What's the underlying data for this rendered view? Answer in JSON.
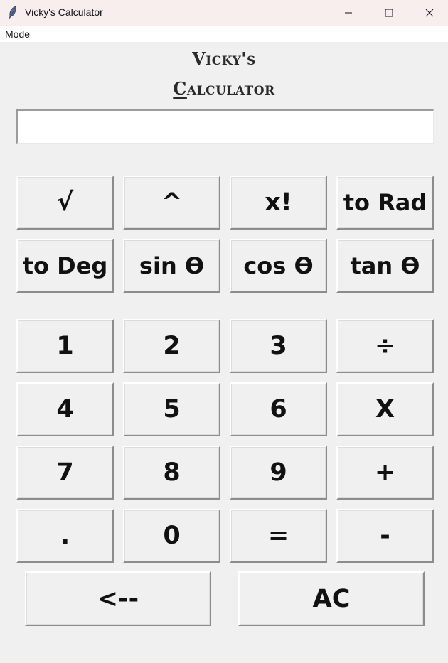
{
  "window": {
    "title": "Vicky's Calculator",
    "icon": "feather-icon"
  },
  "menu": {
    "items": [
      "Mode"
    ]
  },
  "heading": {
    "line1": "Vicky's",
    "line2_first": "C",
    "line2_rest": "alculator"
  },
  "display": {
    "value": ""
  },
  "buttons": {
    "sqrt": "√",
    "power": "^",
    "factorial": "x!",
    "to_rad": "to Rad",
    "to_deg": "to Deg",
    "sin": "sin ϴ",
    "cos": "cos ϴ",
    "tan": "tan ϴ",
    "one": "1",
    "two": "2",
    "three": "3",
    "divide": "÷",
    "four": "4",
    "five": "5",
    "six": "6",
    "multiply": "X",
    "seven": "7",
    "eight": "8",
    "nine": "9",
    "plus": "+",
    "dot": ".",
    "zero": "0",
    "equals": "=",
    "minus": "-",
    "backspace": "<--",
    "clear": "AC"
  },
  "colors": {
    "background": "#f0f0f0",
    "titlebar": "#f8eeee",
    "text": "#111111"
  }
}
